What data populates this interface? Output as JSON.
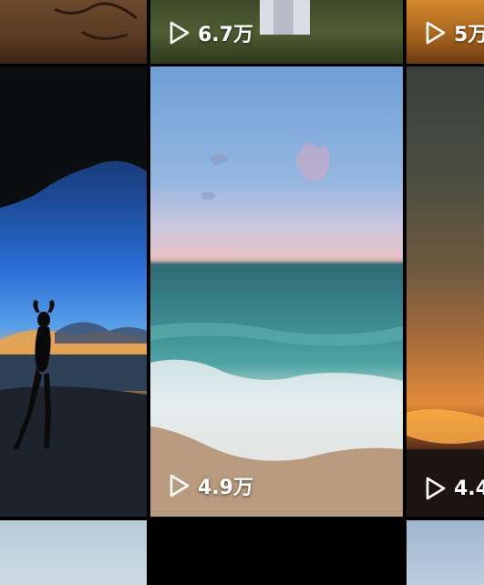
{
  "grid": {
    "row1": [
      {
        "playcount": ""
      },
      {
        "playcount": "6.7万"
      },
      {
        "playcount": "5万"
      }
    ],
    "row2": [
      {
        "playcount": ""
      },
      {
        "playcount": "4.9万"
      },
      {
        "playcount": "4.4"
      }
    ],
    "row3": [
      {
        "playcount": ""
      },
      {
        "playcount": ""
      },
      {
        "playcount": ""
      }
    ]
  },
  "icons": {
    "play": "play-outline-icon"
  },
  "colors": {
    "background": "#000000",
    "text": "#ffffff"
  }
}
